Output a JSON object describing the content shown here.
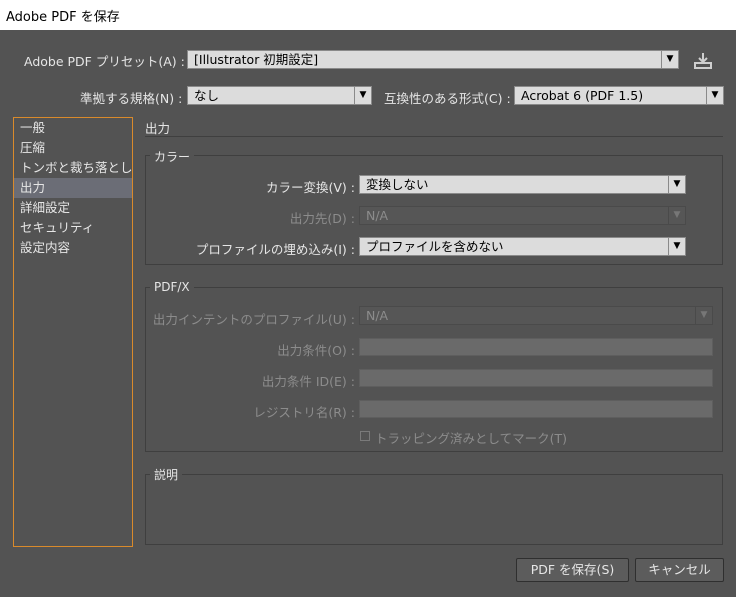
{
  "window": {
    "title": "Adobe PDF を保存"
  },
  "header": {
    "preset_label": "Adobe PDF プリセット(A) :",
    "preset_value": "[Illustrator 初期設定]",
    "standard_label": "準拠する規格(N) :",
    "standard_value": "なし",
    "compat_label": "互換性のある形式(C) :",
    "compat_value": "Acrobat 6 (PDF 1.5)"
  },
  "sidebar": {
    "items": [
      {
        "label": "一般"
      },
      {
        "label": "圧縮"
      },
      {
        "label": "トンボと裁ち落とし"
      },
      {
        "label": "出力"
      },
      {
        "label": "詳細設定"
      },
      {
        "label": "セキュリティ"
      },
      {
        "label": "設定内容"
      }
    ]
  },
  "main": {
    "section_title": "出力",
    "color_group": {
      "title": "カラー",
      "conversion_label": "カラー変換(V) :",
      "conversion_value": "変換しない",
      "destination_label": "出力先(D) :",
      "destination_value": "N/A",
      "profile_label": "プロファイルの埋め込み(I) :",
      "profile_value": "プロファイルを含めない"
    },
    "pdfx_group": {
      "title": "PDF/X",
      "intent_label": "出力インテントのプロファイル(U) :",
      "intent_value": "N/A",
      "condition_label": "出力条件(O) :",
      "condition_id_label": "出力条件 ID(E) :",
      "registry_label": "レジストリ名(R) :",
      "trapped_label": "トラッピング済みとしてマーク(T)"
    },
    "description_title": "説明"
  },
  "footer": {
    "save_label": "PDF を保存(S)",
    "cancel_label": "キャンセル"
  },
  "icons": {
    "arrow": "▼",
    "save_preset": "save-preset-icon"
  },
  "colors": {
    "sidebar_border": "#d98a2b",
    "selection": "#6b6d76"
  }
}
